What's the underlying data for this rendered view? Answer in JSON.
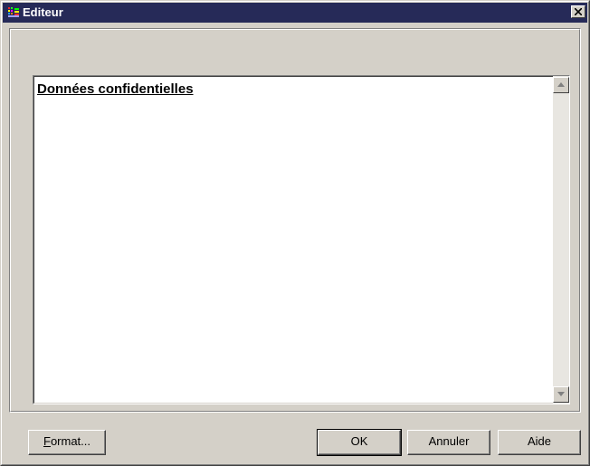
{
  "window": {
    "title": "Editeur",
    "title_bar_color": "#262a58"
  },
  "editor": {
    "content": "Données confidentielles"
  },
  "buttons": {
    "format_accel": "F",
    "format_rest": "ormat...",
    "ok": "OK",
    "cancel": "Annuler",
    "help": "Aide"
  },
  "icons": {
    "app": "app-icon",
    "close": "close-icon",
    "scroll_up": "scroll-up-arrow-icon",
    "scroll_down": "scroll-down-arrow-icon"
  }
}
